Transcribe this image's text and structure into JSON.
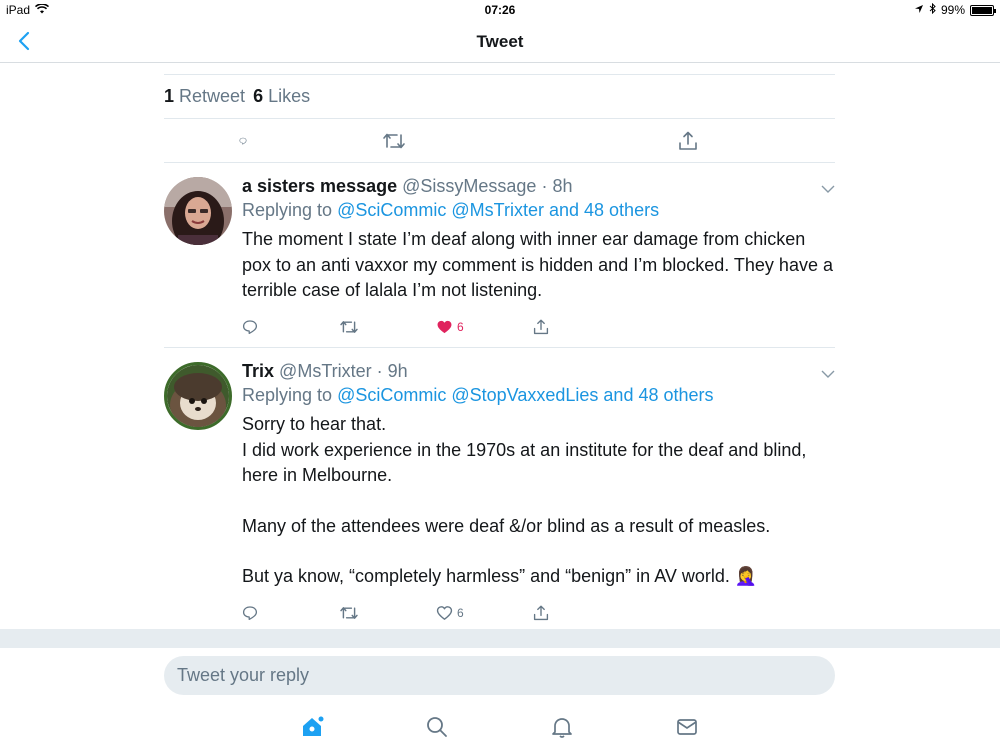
{
  "status_bar": {
    "device": "iPad",
    "time": "07:26",
    "battery": "99%",
    "battery_level": 0.99
  },
  "nav": {
    "title": "Tweet"
  },
  "stats": {
    "retweets": "1",
    "retweets_label": "Retweet",
    "likes": "6",
    "likes_label": "Likes"
  },
  "main_actions": [
    "reply-icon",
    "retweet-icon",
    "like-icon",
    "share-icon"
  ],
  "replies": [
    {
      "name": "a sisters message",
      "handle": "@SissyMessage",
      "time": "8h",
      "replying_prefix": "Replying to",
      "replying_to": [
        "@SciCommic",
        "@MsTrixter",
        "and 48 others"
      ],
      "body": [
        "The moment I state I’m deaf along with inner ear damage from chicken pox to an anti vaxxor my comment is hidden and I’m blocked.  They have a terrible case of lalala I’m not listening."
      ],
      "likes": "6",
      "liked": true
    },
    {
      "name": "Trix",
      "handle": "@MsTrixter",
      "time": "9h",
      "replying_prefix": "Replying to",
      "replying_to": [
        "@SciCommic",
        "@StopVaxxedLies",
        "and 48 others"
      ],
      "body": [
        "Sorry to hear that.",
        "I did work experience in the 1970s at an institute for the deaf and blind, here in Melbourne.",
        "",
        "Many of the attendees were deaf &/or blind as a result of measles.",
        "",
        "But ya know, “completely harmless” and “benign” in AV world. 🤦‍♀️"
      ],
      "likes": "6",
      "liked": false
    }
  ],
  "reply_input": {
    "placeholder": "Tweet your reply",
    "value": ""
  },
  "tabs": [
    "home-icon",
    "search-icon",
    "notifications-icon",
    "messages-icon"
  ],
  "colors": {
    "accent": "#1da1f2",
    "link": "#1b95e0",
    "like": "#e0245e",
    "muted": "#657786"
  }
}
